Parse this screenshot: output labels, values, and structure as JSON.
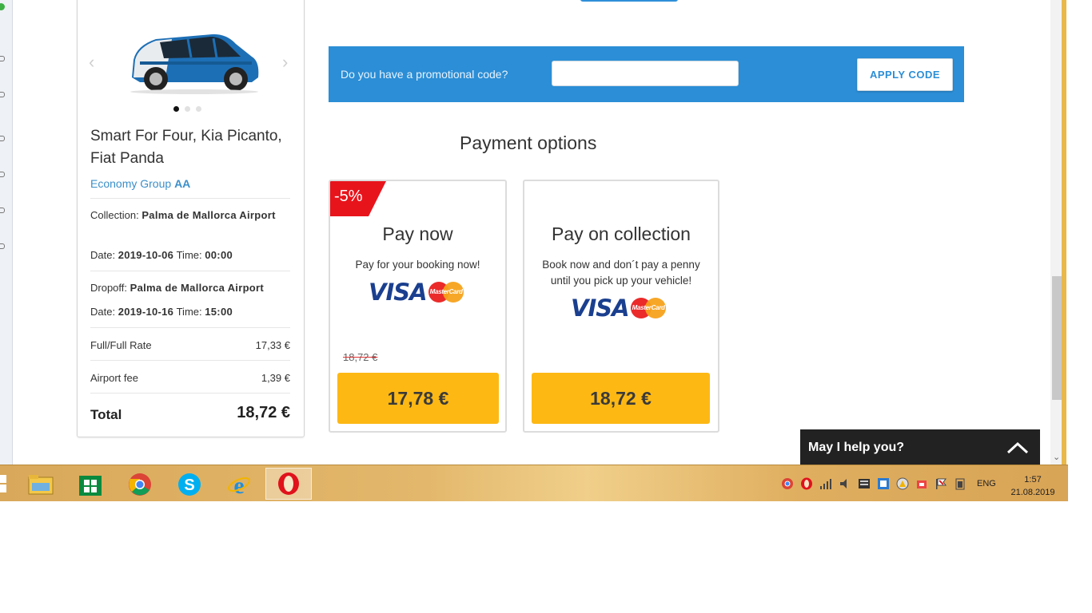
{
  "card": {
    "title": "Smart For Four, Kia Picanto, Fiat Panda",
    "group_label": "Economy Group",
    "group_code": "AA",
    "collection_label": "Collection:",
    "collection_location": "Palma de Mallorca Airport",
    "date_label": "Date:",
    "time_label": "Time:",
    "collection_date": "2019-10-06",
    "collection_time": "00:00",
    "dropoff_label": "Dropoff:",
    "dropoff_location": "Palma de Mallorca Airport",
    "dropoff_date": "2019-10-16",
    "dropoff_time": "15:00",
    "rate_label": "Full/Full Rate",
    "rate_value": "17,33 €",
    "fee_label": "Airport fee",
    "fee_value": "1,39 €",
    "total_label": "Total",
    "total_value": "18,72 €",
    "prev_arrow": "‹",
    "next_arrow": "›"
  },
  "promo": {
    "question": "Do you have a promotional code?",
    "input_value": "",
    "input_placeholder": "",
    "apply_label": "APPLY CODE"
  },
  "payment": {
    "title": "Payment options",
    "pay_now": {
      "badge": "-5%",
      "title": "Pay now",
      "description": "Pay for your booking now!",
      "old_price": "18,72 €",
      "price": "17,78 €"
    },
    "pay_collection": {
      "title": "Pay on collection",
      "description_line1": "Book now and don´t pay a penny",
      "description_line2": "until you pick up your vehicle!",
      "price": "18,72 €"
    },
    "visa_text": "VISA",
    "mastercard_text": "MasterCard"
  },
  "chat": {
    "label": "May I help you?"
  },
  "taskbar": {
    "language": "ENG",
    "time": "1:57",
    "date": "21.08.2019"
  },
  "colors": {
    "promo_bg": "#2b8ed6",
    "price_button": "#fdb814",
    "badge_red": "#e8141c",
    "chat_bg": "#222222",
    "link_blue": "#3b8fc9"
  }
}
